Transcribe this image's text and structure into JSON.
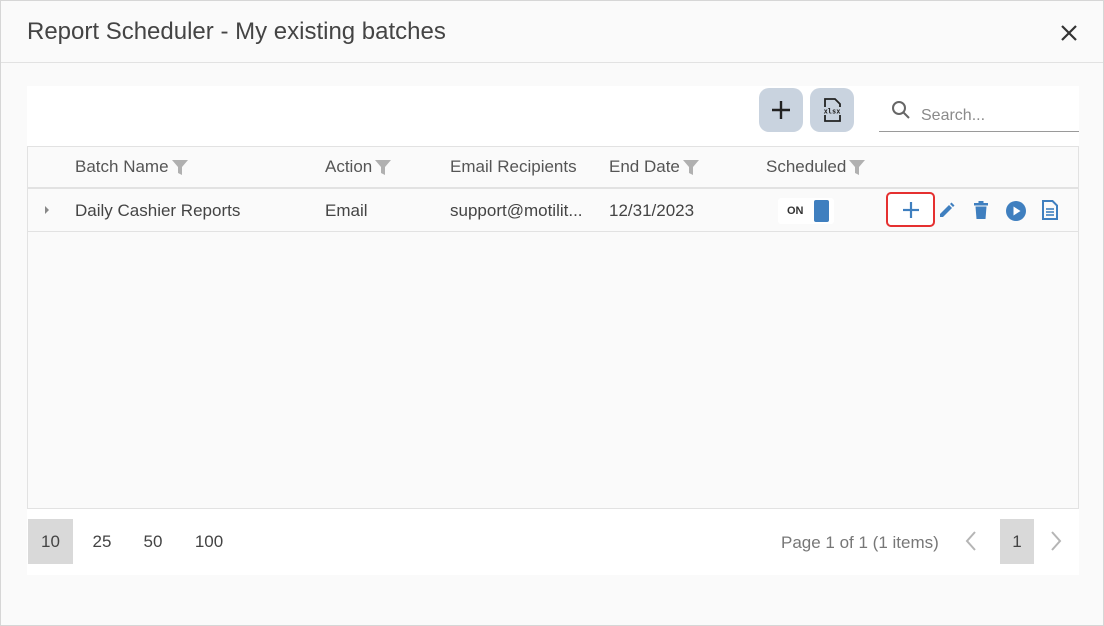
{
  "dialog": {
    "title": "Report Scheduler - My existing batches"
  },
  "toolbar": {
    "add_icon": "plus-icon",
    "export_icon": "xlsx-icon",
    "export_text": "xlsx",
    "search_placeholder": "Search..."
  },
  "grid": {
    "columns": [
      {
        "label": "Batch Name",
        "filter": true
      },
      {
        "label": "Action",
        "filter": true
      },
      {
        "label": "Email Recipients",
        "filter": false
      },
      {
        "label": "End Date",
        "filter": true
      },
      {
        "label": "Scheduled",
        "filter": true
      }
    ],
    "rows": [
      {
        "batch_name": "Daily Cashier Reports",
        "action": "Email",
        "email_recipients": "support@motilit...",
        "end_date": "12/31/2023",
        "scheduled": "ON",
        "actions": [
          "plus-icon",
          "pencil-icon",
          "trash-icon",
          "play-icon",
          "document-icon"
        ]
      }
    ]
  },
  "pager": {
    "page_sizes": [
      "10",
      "25",
      "50",
      "100"
    ],
    "active_page_size": "10",
    "info": "Page 1 of 1 (1 items)",
    "current_page": "1"
  },
  "colors": {
    "accent": "#3f7fbf",
    "highlight_border": "#e53030",
    "toolbar_button": "#c9d3df",
    "filter_icon": "#b0b0b0"
  }
}
